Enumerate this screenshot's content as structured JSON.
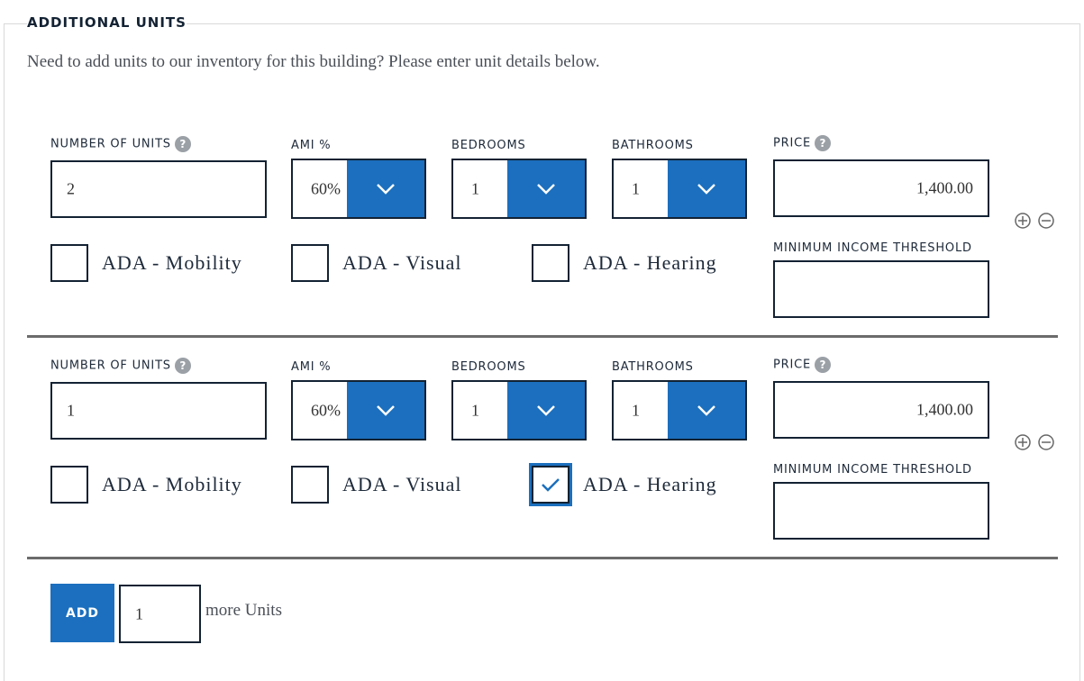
{
  "section": {
    "legend": "ADDITIONAL UNITS",
    "intro": "Need to add units to our inventory for this building? Please enter unit details below."
  },
  "labels": {
    "number_of_units": "NUMBER OF UNITS",
    "ami": "AMI %",
    "bedrooms": "BEDROOMS",
    "bathrooms": "BATHROOMS",
    "price": "PRICE",
    "min_income": "MINIMUM INCOME THRESHOLD",
    "help": "?"
  },
  "units": [
    {
      "number_of_units": "2",
      "ami": "60%",
      "bedrooms": "1",
      "bathrooms": "1",
      "price": "1,400.00",
      "min_income": "",
      "ada": [
        {
          "label": "ADA - Mobility",
          "checked": false
        },
        {
          "label": "ADA - Visual",
          "checked": false
        },
        {
          "label": "ADA - Hearing",
          "checked": false
        }
      ]
    },
    {
      "number_of_units": "1",
      "ami": "60%",
      "bedrooms": "1",
      "bathrooms": "1",
      "price": "1,400.00",
      "min_income": "",
      "ada": [
        {
          "label": "ADA - Mobility",
          "checked": false
        },
        {
          "label": "ADA - Visual",
          "checked": false
        },
        {
          "label": "ADA - Hearing",
          "checked": true
        }
      ]
    }
  ],
  "footer": {
    "add_label": "ADD",
    "add_count": "1",
    "more_units_text": "more Units"
  },
  "colors": {
    "accent": "#1b6fbe",
    "border": "#132233",
    "divider": "#6b6b6b"
  }
}
